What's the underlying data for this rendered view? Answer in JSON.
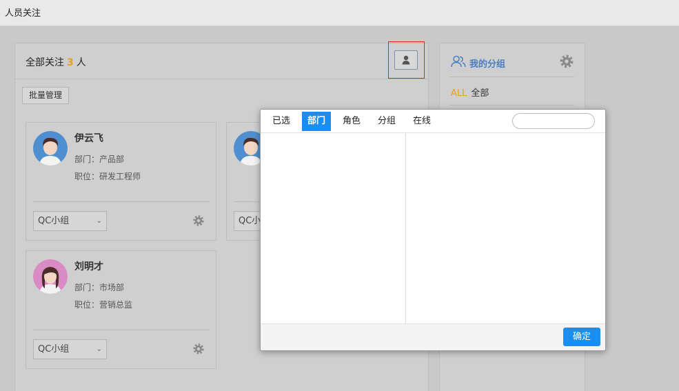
{
  "window": {
    "title": "人员关注"
  },
  "main": {
    "title_prefix": "全部关注",
    "count": "3",
    "title_suffix": "人",
    "batch_button": "批量管理",
    "person_icon": "person-icon"
  },
  "cards": [
    {
      "name": "伊云飞",
      "dept": "部门：产品部",
      "pos": "职位：研发工程师",
      "group": "QC小组",
      "avatar": "male-avatar"
    },
    {
      "name": "",
      "dept": "",
      "pos": "",
      "group": "QC小",
      "avatar": "male-avatar"
    },
    {
      "name": "刘明才",
      "dept": "部门：市场部",
      "pos": "职位：营销总监",
      "group": "QC小组",
      "avatar": "female-avatar"
    }
  ],
  "sidebar": {
    "title": "我的分组",
    "all_tag": "ALL",
    "all_label": "全部"
  },
  "modal": {
    "tabs": [
      "已选",
      "部门",
      "角色",
      "分组",
      "在线"
    ],
    "active_tab": "部门",
    "search_placeholder": "",
    "ok_button": "确定"
  },
  "colors": {
    "accent": "#1a8ef0",
    "count": "#e6a020",
    "sidebar_title": "#4a7fc1",
    "highlight": "#e02020"
  }
}
